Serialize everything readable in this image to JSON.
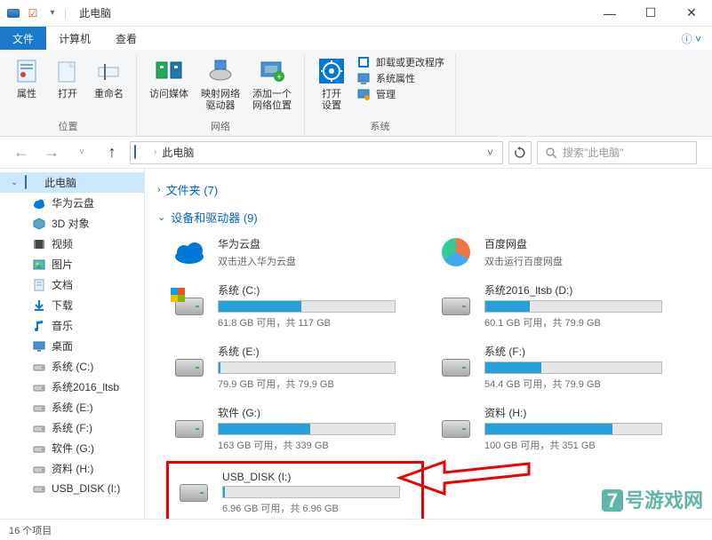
{
  "title": "此电脑",
  "menu": {
    "file": "文件",
    "computer": "计算机",
    "view": "查看"
  },
  "ribbon": {
    "location": {
      "label": "位置",
      "properties": "属性",
      "open": "打开",
      "rename": "重命名"
    },
    "network": {
      "label": "网络",
      "access_media": "访问媒体",
      "map_drive": "映射网络\n驱动器",
      "add_location": "添加一个\n网络位置"
    },
    "system": {
      "label": "系统",
      "open_settings": "打开\n设置",
      "uninstall": "卸载或更改程序",
      "sys_props": "系统属性",
      "manage": "管理"
    }
  },
  "nav": {
    "path": "此电脑",
    "search_placeholder": "搜索\"此电脑\""
  },
  "sidebar": {
    "items": [
      {
        "label": "此电脑",
        "root": true,
        "selected": true,
        "icon": "monitor"
      },
      {
        "label": "华为云盘",
        "icon": "cloud"
      },
      {
        "label": "3D 对象",
        "icon": "3d"
      },
      {
        "label": "视频",
        "icon": "video"
      },
      {
        "label": "图片",
        "icon": "image"
      },
      {
        "label": "文档",
        "icon": "document"
      },
      {
        "label": "下载",
        "icon": "download"
      },
      {
        "label": "音乐",
        "icon": "music"
      },
      {
        "label": "桌面",
        "icon": "desktop"
      },
      {
        "label": "系统 (C:)",
        "icon": "drive"
      },
      {
        "label": "系统2016_ltsb",
        "icon": "drive"
      },
      {
        "label": "系统 (E:)",
        "icon": "drive"
      },
      {
        "label": "系统 (F:)",
        "icon": "drive"
      },
      {
        "label": "软件 (G:)",
        "icon": "drive"
      },
      {
        "label": "资料 (H:)",
        "icon": "drive"
      },
      {
        "label": "USB_DISK (I:)",
        "icon": "drive"
      }
    ]
  },
  "content": {
    "folders_header": "文件夹 (7)",
    "drives_header": "设备和驱动器 (9)",
    "cloud_items": [
      {
        "name": "华为云盘",
        "sub": "双击进入华为云盘",
        "icon": "huawei"
      },
      {
        "name": "百度网盘",
        "sub": "双击运行百度网盘",
        "icon": "baidu"
      }
    ],
    "drives": [
      {
        "name": "系统 (C:)",
        "free": "61.8 GB 可用，共 117 GB",
        "pct": 47,
        "win": true
      },
      {
        "name": "系统2016_ltsb (D:)",
        "free": "60.1 GB 可用，共 79.9 GB",
        "pct": 25
      },
      {
        "name": "系统 (E:)",
        "free": "79.9 GB 可用，共 79.9 GB",
        "pct": 1
      },
      {
        "name": "系统 (F:)",
        "free": "54.4 GB 可用，共 79.9 GB",
        "pct": 32
      },
      {
        "name": "软件 (G:)",
        "free": "163 GB 可用，共 339 GB",
        "pct": 52
      },
      {
        "name": "资料 (H:)",
        "free": "100 GB 可用，共 351 GB",
        "pct": 72
      },
      {
        "name": "USB_DISK (I:)",
        "free": "6.96 GB 可用，共 6.96 GB",
        "pct": 1,
        "highlight": true
      }
    ]
  },
  "status": "16 个项目",
  "watermark": {
    "num": "7",
    "text": "号游戏网"
  }
}
